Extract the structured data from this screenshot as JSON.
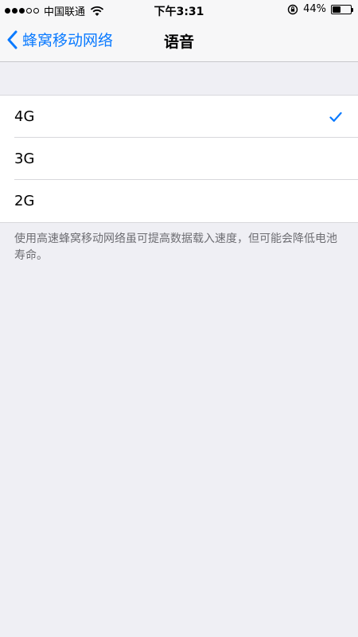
{
  "status_bar": {
    "carrier": "中国联通",
    "time": "下午3:31",
    "battery_percent": "44%",
    "battery_level": 0.44,
    "signal_bars_filled": 3,
    "signal_bars_total": 5
  },
  "nav": {
    "back_label": "蜂窝移动网络",
    "title": "语音"
  },
  "options": [
    {
      "label": "4G",
      "selected": true
    },
    {
      "label": "3G",
      "selected": false
    },
    {
      "label": "2G",
      "selected": false
    }
  ],
  "footnote": "使用高速蜂窝移动网络虽可提高数据载入速度，但可能会降低电池寿命。",
  "colors": {
    "accent": "#0a7aff",
    "background": "#efeff4"
  },
  "icons": [
    "wifi-icon",
    "lock-icon",
    "battery-icon",
    "chevron-left-icon",
    "check-icon"
  ]
}
